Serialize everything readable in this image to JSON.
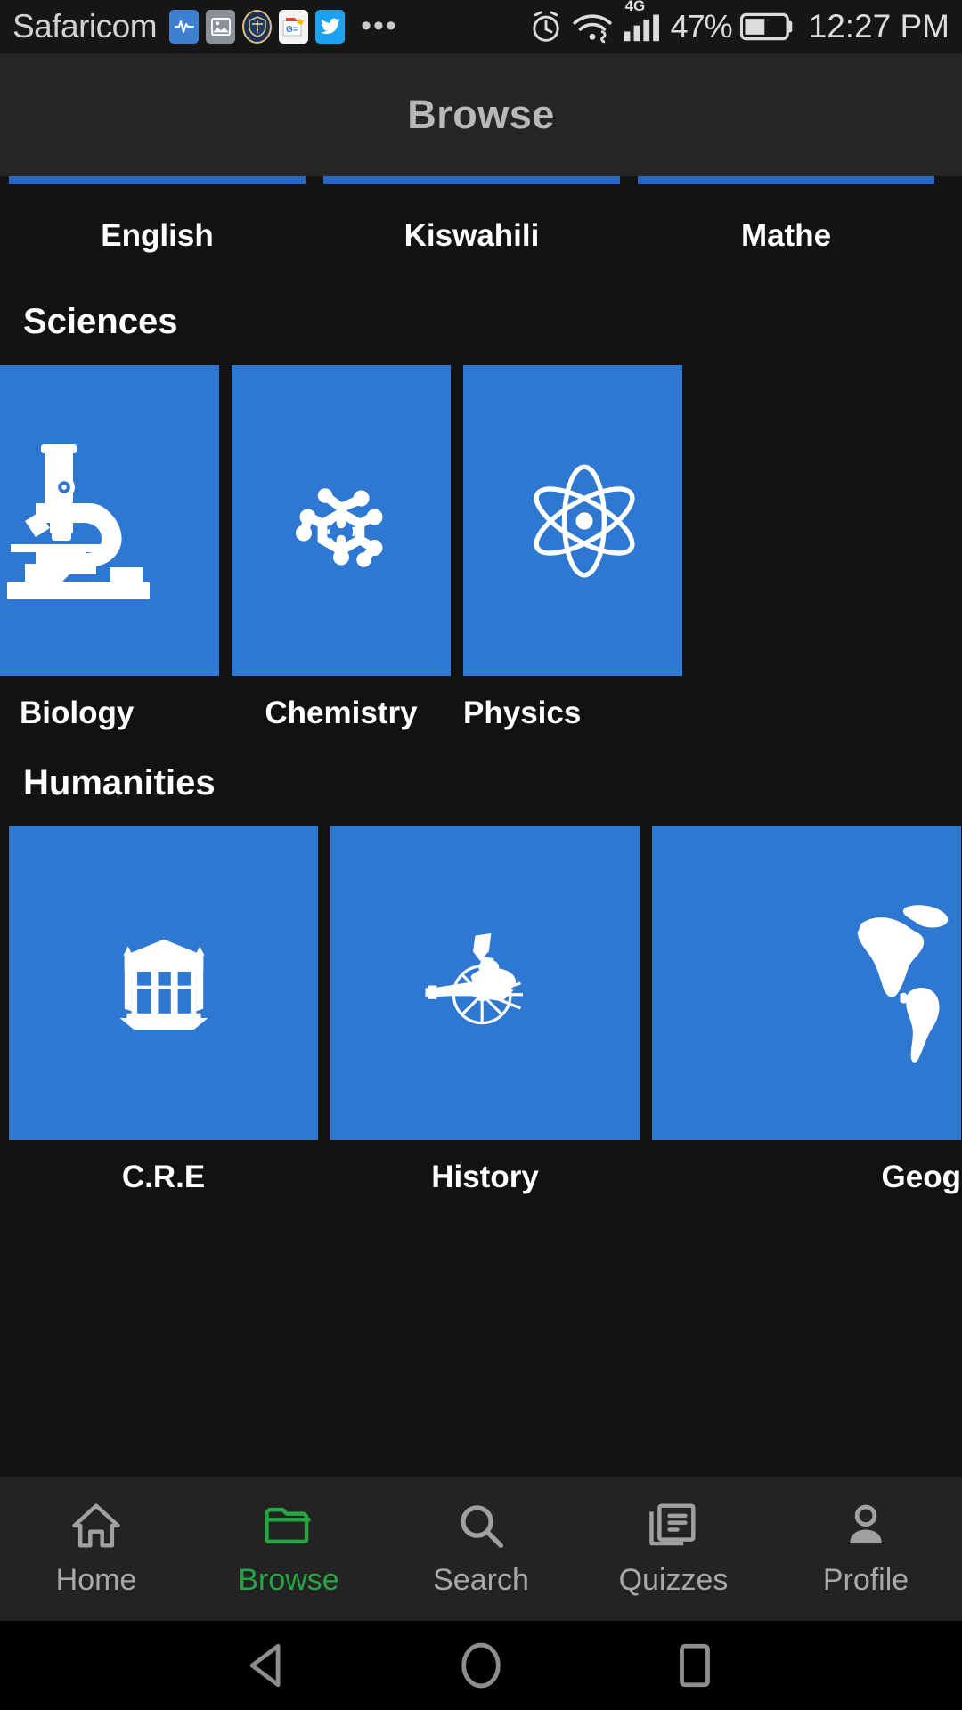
{
  "statusbar": {
    "carrier": "Safaricom",
    "app_icons": [
      "health-icon",
      "photo-icon",
      "badge-icon",
      "google-news-icon",
      "twitter-icon"
    ],
    "overflow": "•••",
    "alarm_icon": "alarm-icon",
    "wifi_icon": "wifi-icon",
    "network_label": "4G",
    "signal_icon": "signal-bars-icon",
    "battery_percent": "47%",
    "battery_icon": "battery-half-icon",
    "time": "12:27 PM"
  },
  "appbar": {
    "title": "Browse"
  },
  "tabs": [
    {
      "label": "English",
      "active": true
    },
    {
      "label": "Kiswahili",
      "active": true
    },
    {
      "label": "Mathe",
      "active": true
    }
  ],
  "sections": [
    {
      "title": "Sciences",
      "items": [
        {
          "label": "Biology",
          "icon": "microscope-icon"
        },
        {
          "label": "Chemistry",
          "icon": "molecule-icon"
        },
        {
          "label": "Physics",
          "icon": "atom-icon"
        }
      ]
    },
    {
      "title": "Humanities",
      "items": [
        {
          "label": "C.R.E",
          "icon": "temple-icon"
        },
        {
          "label": "History",
          "icon": "cannon-icon"
        },
        {
          "label": "Geog",
          "icon": "world-map-icon"
        }
      ]
    }
  ],
  "bottom_nav": [
    {
      "label": "Home",
      "icon": "home-icon",
      "active": false
    },
    {
      "label": "Browse",
      "icon": "folder-icon",
      "active": true
    },
    {
      "label": "Search",
      "icon": "search-icon",
      "active": false
    },
    {
      "label": "Quizzes",
      "icon": "documents-icon",
      "active": false
    },
    {
      "label": "Profile",
      "icon": "person-icon",
      "active": false
    }
  ],
  "android_nav": [
    {
      "icon": "back-triangle-icon"
    },
    {
      "icon": "home-circle-icon"
    },
    {
      "icon": "recents-square-icon"
    }
  ],
  "colors": {
    "tile_blue": "#2e78d2",
    "tab_indicator": "#2967c8",
    "active_nav_green": "#26a544",
    "background": "#121212",
    "appbar": "#252525",
    "bottom_nav_bg": "#232323"
  }
}
